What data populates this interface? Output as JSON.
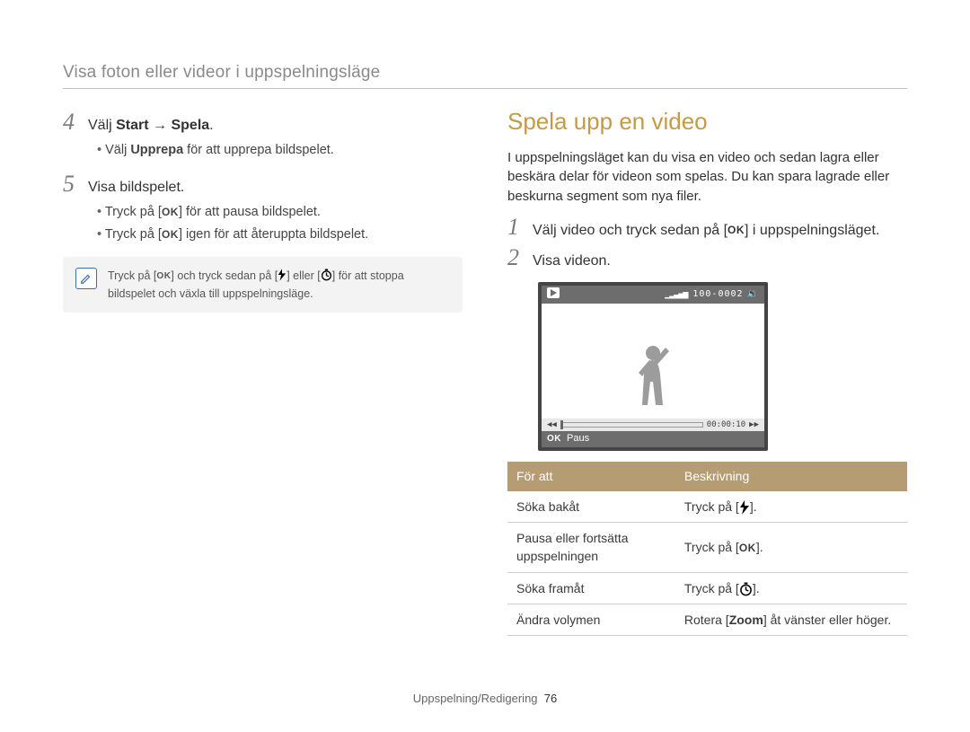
{
  "header": {
    "title": "Visa foton eller videor i uppspelningsläge"
  },
  "left": {
    "step4": {
      "num": "4",
      "pre": "Välj ",
      "b1": "Start",
      "arrow": " → ",
      "b2": "Spela",
      "post": "."
    },
    "step4_sub": {
      "pre": "Välj ",
      "b": "Upprepa",
      "post": " för att upprepa bildspelet."
    },
    "step5": {
      "num": "5",
      "text": "Visa bildspelet."
    },
    "step5_sub1": {
      "pre": "Tryck på [",
      "post": "] för att pausa bildspelet."
    },
    "step5_sub2": {
      "pre": "Tryck på [",
      "post": "] igen för att återuppta bildspelet."
    },
    "note": {
      "pre": "Tryck på [",
      "mid1": "] och tryck sedan på [",
      "mid2": "] eller [",
      "post": "] för att stoppa bildspelet och växla till uppspelningsläge."
    }
  },
  "right": {
    "heading": "Spela upp en video",
    "intro": "I uppspelningsläget kan du visa en video och sedan lagra eller beskära delar för videon som spelas. Du kan spara lagrade eller beskurna segment som nya filer.",
    "step1": {
      "num": "1",
      "pre": "Välj video och tryck sedan på [",
      "post": "] i uppspelningsläget."
    },
    "step2": {
      "num": "2",
      "text": "Visa videon."
    },
    "video": {
      "top_label": "100-0002",
      "time": "00:00:10",
      "paus": "Paus"
    },
    "table": {
      "th1": "För att",
      "th2": "Beskrivning",
      "r1c1": "Söka bakåt",
      "r1c2_pre": "Tryck på [",
      "r1c2_post": "].",
      "r2c1": "Pausa eller fortsätta uppspelningen",
      "r2c2_pre": "Tryck på [",
      "r2c2_post": "].",
      "r3c1": "Söka framåt",
      "r3c2_pre": "Tryck på [",
      "r3c2_post": "].",
      "r4c1": "Ändra volymen",
      "r4c2_pre": "Rotera [",
      "r4c2_b": "Zoom",
      "r4c2_post": "] åt vänster eller höger."
    }
  },
  "footer": {
    "section": "Uppspelning/Redigering",
    "page": "76"
  },
  "icons": {
    "ok_label": "OK"
  }
}
